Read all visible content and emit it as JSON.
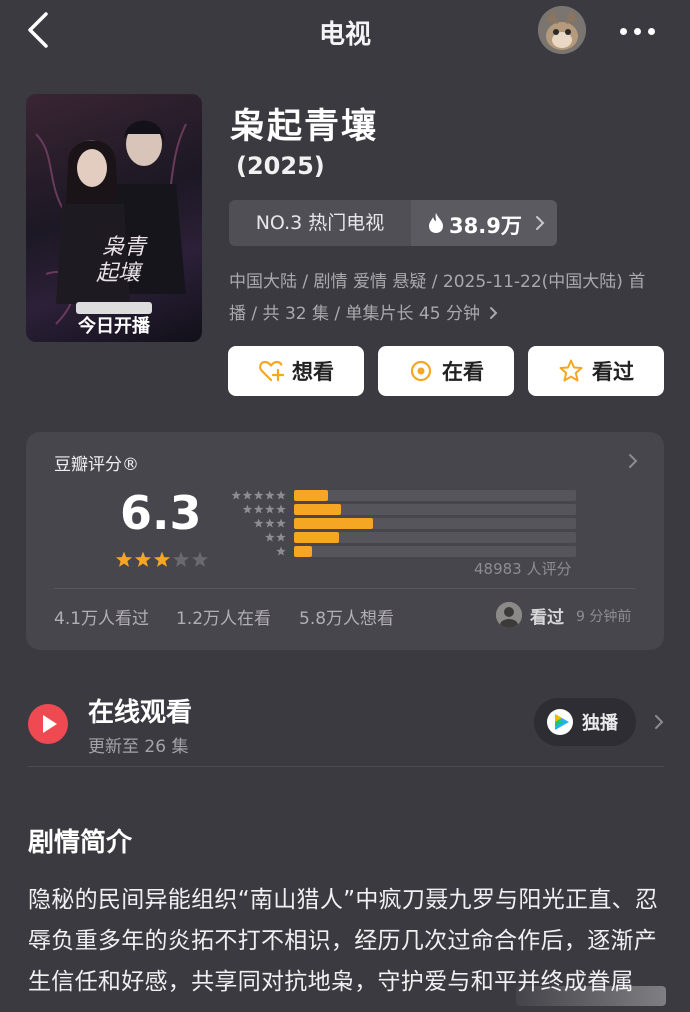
{
  "header": {
    "title": "电视",
    "back_icon": "chevron-left-icon",
    "more_icon": "more-dots-icon"
  },
  "show": {
    "title": "枭起青壤",
    "year": "(2025)",
    "poster_caption": "今日开播",
    "rank_label": "NO.3 热门电视",
    "heat_value": "38.9万",
    "meta": "中国大陆 / 剧情 爱情 悬疑 / 2025-11-22(中国大陆) 首播 / 共 32 集 / 单集片长 45 分钟"
  },
  "actions": {
    "want_label": "想看",
    "watching_label": "在看",
    "watched_label": "看过"
  },
  "rating": {
    "label": "豆瓣评分®",
    "score": "6.3",
    "score_stars": 3,
    "distribution": [
      0.15,
      0.21,
      0.35,
      0.2,
      0.08
    ],
    "count_text": "48983 人评分",
    "stats": {
      "watched": "4.1万人看过",
      "watching": "1.2万人在看",
      "want": "5.8万人想看"
    },
    "friend_action": "看过",
    "friend_time": "9 分钟前"
  },
  "online": {
    "title": "在线观看",
    "subtitle": "更新至 26 集",
    "exclusive_label": "独播"
  },
  "synopsis": {
    "title": "剧情简介",
    "body": "隐秘的民间异能组织“南山猎人”中疯刀聂九罗与阳光正直、忍辱负重多年的炎拓不打不相识，经历几次过命合作后，逐渐产生信任和好感，共享同对抗地枭，守护爱与和平并终成眷属"
  },
  "colors": {
    "background": "#3b3a40",
    "card": "#47464c",
    "accent_star": "#f5a623",
    "play_red": "#ef4a52"
  }
}
